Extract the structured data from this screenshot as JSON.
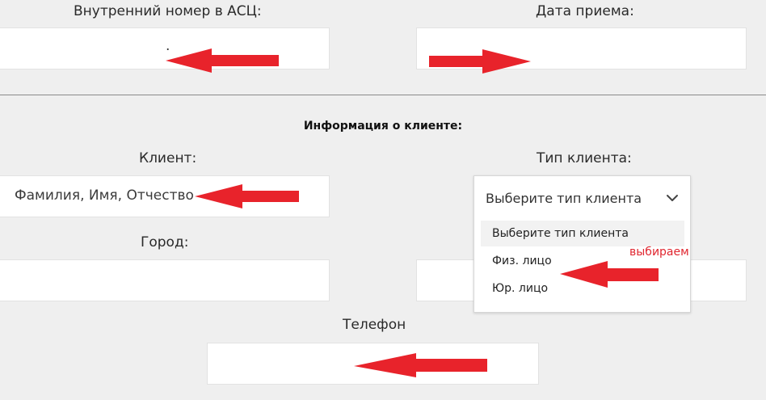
{
  "top": {
    "internal_number_label": "Внутренний номер в АСЦ:",
    "internal_number_value": ".",
    "date_label": "Дата приема:",
    "date_value": ""
  },
  "client_section": {
    "title": "Информация о клиенте:",
    "client_label": "Клиент:",
    "client_placeholder": "Фамилия, Имя, Отчество",
    "client_type_label": "Тип клиента:",
    "client_type_selected": "Выберите тип клиента",
    "client_type_options": [
      "Выберите тип клиента",
      "Физ. лицо",
      "Юр. лицо"
    ],
    "city_label": "Город:",
    "city_value": "",
    "phone_label": "Телефон",
    "phone_value": ""
  },
  "annotations": {
    "note": "выбираем",
    "arrow_color": "#e8232b"
  },
  "icons": {
    "dropdown": "chevron-down-icon"
  }
}
